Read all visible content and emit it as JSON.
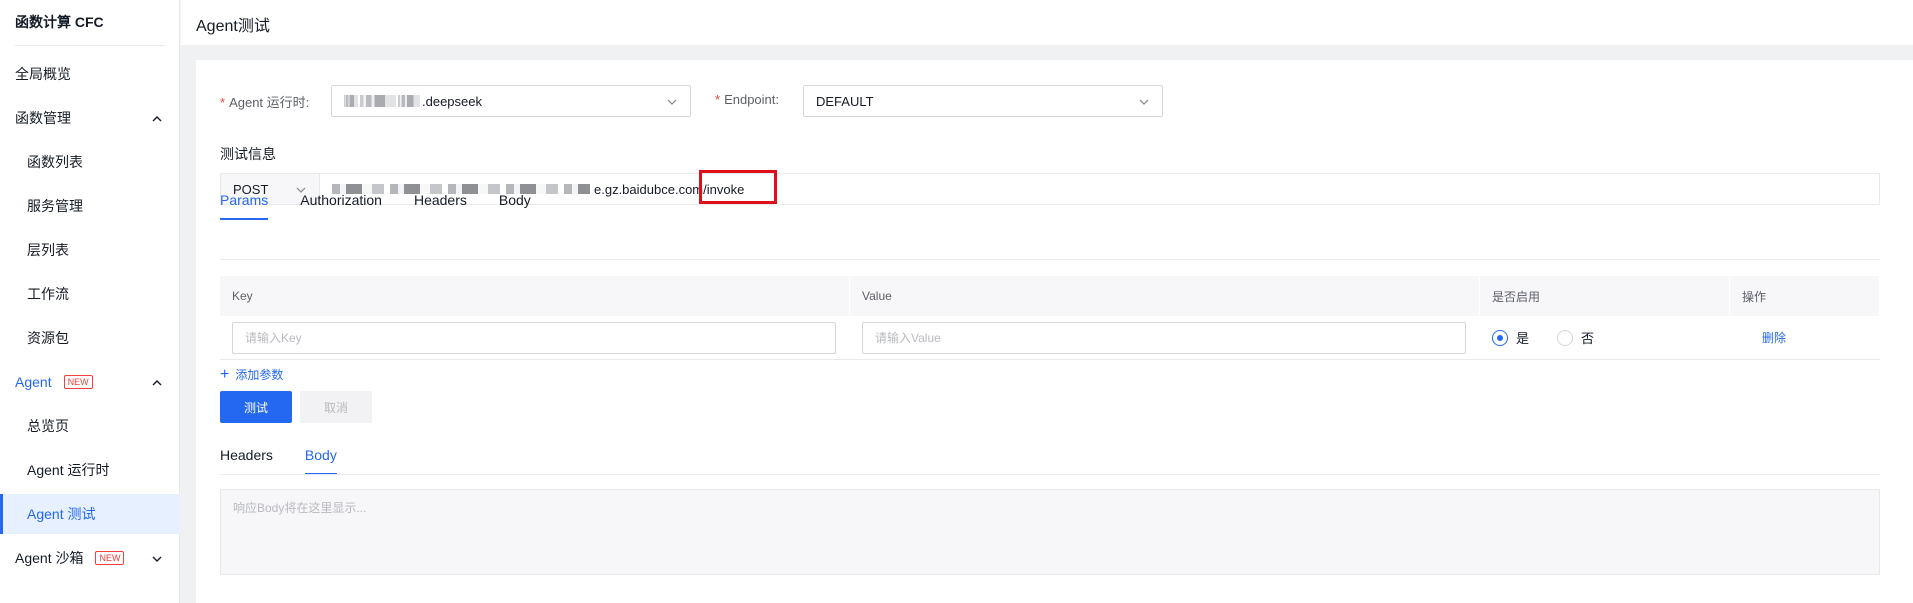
{
  "sidebar": {
    "title": "函数计算 CFC",
    "items": [
      {
        "label": "全局概览"
      },
      {
        "label": "函数管理"
      },
      {
        "label": "函数列表"
      },
      {
        "label": "服务管理"
      },
      {
        "label": "层列表"
      },
      {
        "label": "工作流"
      },
      {
        "label": "资源包"
      },
      {
        "label": "Agent",
        "badge": "NEW"
      },
      {
        "label": "总览页"
      },
      {
        "label": "Agent 运行时"
      },
      {
        "label": "Agent 测试"
      },
      {
        "label": "Agent 沙箱",
        "badge": "NEW"
      }
    ]
  },
  "header": {
    "title": "Agent测试"
  },
  "form": {
    "runtime_label": "Agent 运行时:",
    "runtime_value": ".deepseek",
    "endpoint_label": "Endpoint:",
    "endpoint_value": "DEFAULT"
  },
  "test_info": {
    "title": "测试信息",
    "method": "POST",
    "url_visible": "e.gz.baidubce.com/invoke"
  },
  "request_tabs": [
    "Params",
    "Authorization",
    "Headers",
    "Body"
  ],
  "params_table": {
    "columns": [
      "Key",
      "Value",
      "是否启用",
      "操作"
    ],
    "rows": [
      {
        "key_placeholder": "请输入Key",
        "value_placeholder": "请输入Value",
        "enabled_yes": "是",
        "enabled_no": "否",
        "action": "删除"
      }
    ]
  },
  "add_param_label": "添加参数",
  "buttons": {
    "test": "测试",
    "cancel": "取消"
  },
  "response_tabs": [
    "Headers",
    "Body"
  ],
  "response": {
    "placeholder": "响应Body将在这里显示..."
  },
  "colors": {
    "accent": "#2468f2",
    "highlight_box": "#e00f1b",
    "required": "#f33e3e"
  }
}
